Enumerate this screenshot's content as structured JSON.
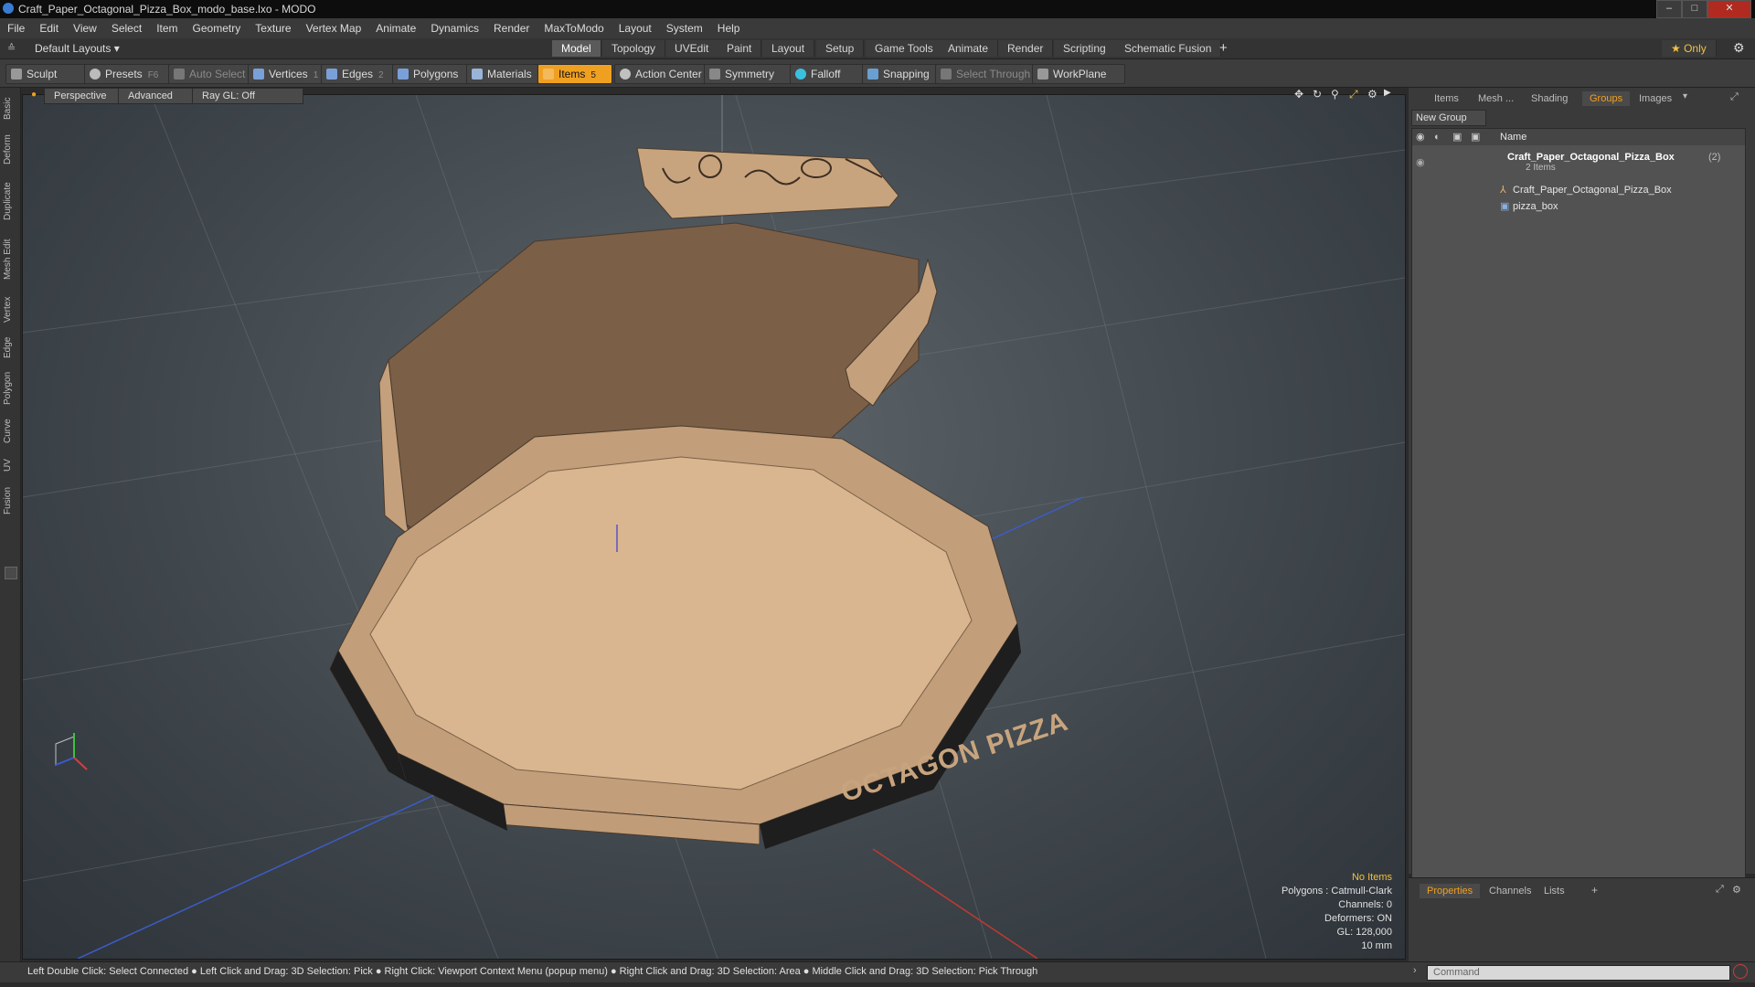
{
  "window": {
    "title": "Craft_Paper_Octagonal_Pizza_Box_modo_base.lxo - MODO",
    "minimize": "–",
    "maximize": "□",
    "close": "✕"
  },
  "menu": [
    "File",
    "Edit",
    "View",
    "Select",
    "Item",
    "Geometry",
    "Texture",
    "Vertex Map",
    "Animate",
    "Dynamics",
    "Render",
    "MaxToModo",
    "Layout",
    "System",
    "Help"
  ],
  "layouts": {
    "default_label": "Default Layouts ▾",
    "tabs": [
      "Model",
      "Topology",
      "UVEdit",
      "Paint",
      "Layout",
      "Setup",
      "Game Tools",
      "Animate",
      "Render",
      "Scripting",
      "Schematic Fusion"
    ],
    "active_tab": "Model",
    "add": "+",
    "only_label": "★  Only"
  },
  "toolbar": {
    "sculpt": "Sculpt",
    "presets": "Presets",
    "presets_key": "F6",
    "auto_select": "Auto Select",
    "vertices": "Vertices",
    "vertices_count": "1",
    "edges": "Edges",
    "edges_count": "2",
    "polygons": "Polygons",
    "materials": "Materials",
    "items": "Items",
    "items_count": "5",
    "action_center": "Action Center",
    "symmetry": "Symmetry",
    "falloff": "Falloff",
    "snapping": "Snapping",
    "select_through": "Select Through",
    "workplane": "WorkPlane"
  },
  "left_tabs": [
    "Basic",
    "Deform",
    "Duplicate",
    "Mesh Edit",
    "Vertex",
    "Edge",
    "Polygon",
    "Curve",
    "UV",
    "Fusion"
  ],
  "viewport": {
    "view": "Perspective",
    "advanced": "Advanced",
    "raygl": "Ray GL: Off",
    "box_print": "OCTAGON PIZZA",
    "info": {
      "no_items": "No Items",
      "polygons": "Polygons : Catmull-Clark",
      "channels": "Channels: 0",
      "deformers": "Deformers: ON",
      "gl": "GL: 128,000",
      "scale": "10 mm"
    }
  },
  "right_panel": {
    "tabs": [
      "Items",
      "Mesh ...",
      "Shading",
      "Groups",
      "Images"
    ],
    "active_tab": "Groups",
    "new_group": "New Group",
    "column_name": "Name",
    "group_name": "Craft_Paper_Octagonal_Pizza_Box",
    "group_count": "(2)",
    "group_sub": "2 Items",
    "children": [
      "Craft_Paper_Octagonal_Pizza_Box",
      "pizza_box"
    ]
  },
  "bottom_panel": {
    "tabs": [
      "Properties",
      "Channels",
      "Lists"
    ],
    "active_tab": "Properties",
    "add": "+"
  },
  "status": {
    "hint": "Left Double Click: Select Connected ● Left Click and Drag: 3D Selection: Pick ● Right Click: Viewport Context Menu (popup menu) ● Right Click and Drag: 3D Selection: Area ● Middle Click and Drag: 3D Selection: Pick Through",
    "command_placeholder": "Command"
  },
  "colors": {
    "accent": "#f0a020",
    "cardboard_light": "#d8b48c",
    "cardboard_dark": "#7a6048",
    "print_black": "#1e1e1e"
  }
}
